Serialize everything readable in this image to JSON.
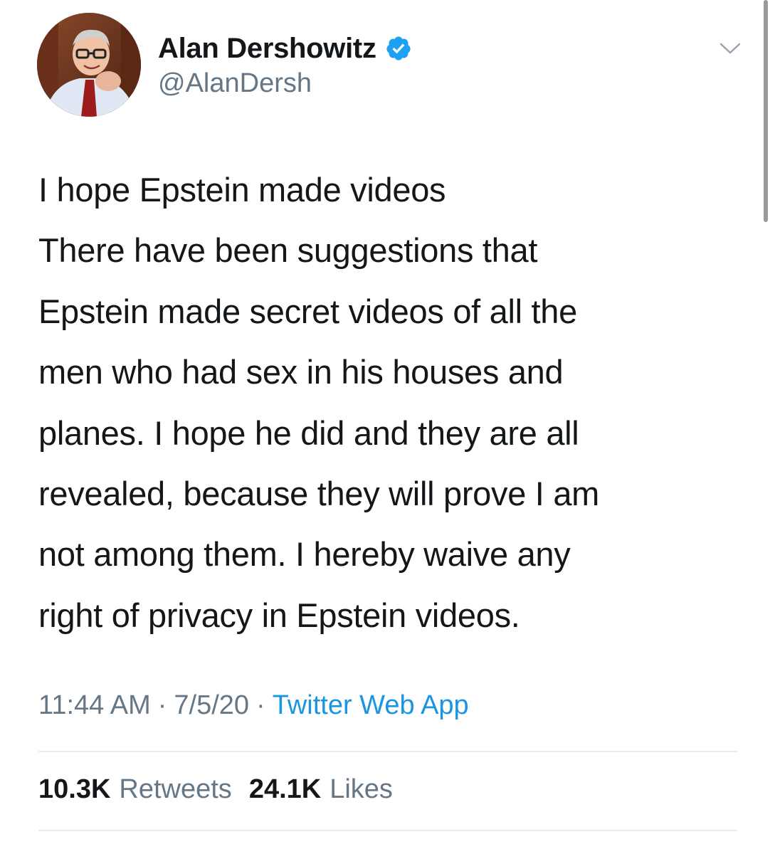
{
  "author": {
    "display_name": "Alan Dershowitz",
    "handle": "@AlanDersh",
    "verified": true
  },
  "tweet": {
    "lines": [
      "I hope Epstein made videos",
      "There have been suggestions that",
      "Epstein made secret videos of all the",
      "men who had sex in his houses and",
      "planes. I hope he did and they are all",
      "revealed, because they will prove I am",
      "not among them. I hereby waive any",
      "right of privacy in Epstein videos."
    ],
    "time": "11:44 AM",
    "date": "7/5/20",
    "separator": "·",
    "source": "Twitter Web App"
  },
  "stats": {
    "retweets_count": "10.3K",
    "retweets_label": "Retweets",
    "likes_count": "24.1K",
    "likes_label": "Likes"
  },
  "icons": {
    "verified": "verified-badge-icon",
    "menu": "chevron-down-icon"
  },
  "colors": {
    "text": "#14171a",
    "secondary": "#657786",
    "link": "#1b95e0",
    "verified": "#1da1f2",
    "divider": "#e6ecf0"
  }
}
